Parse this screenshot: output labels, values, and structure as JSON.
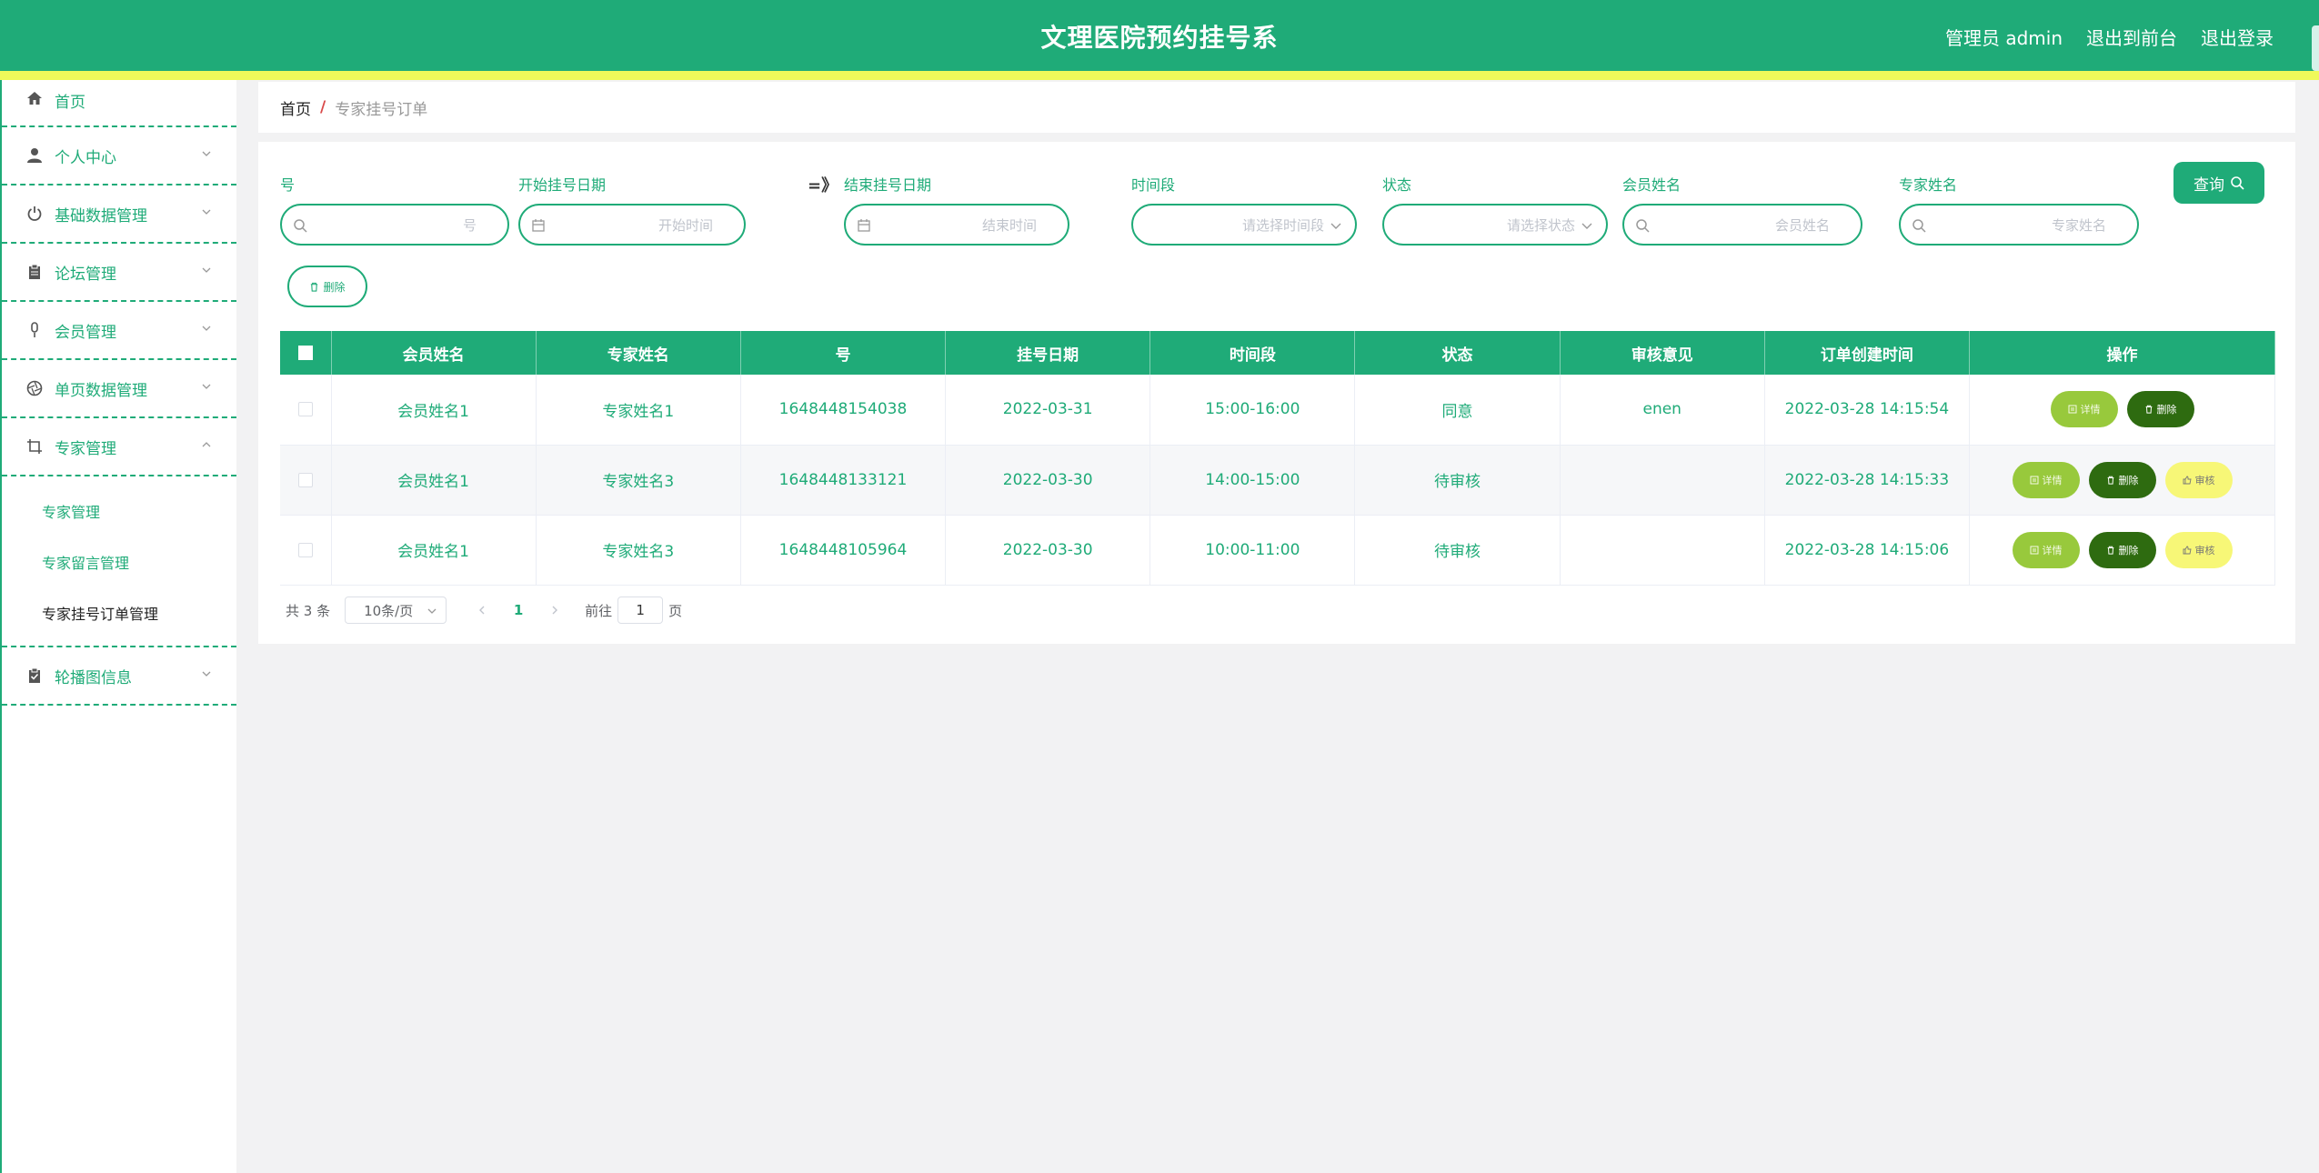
{
  "header": {
    "title": "文理医院预约挂号系",
    "user_label": "管理员 admin",
    "back_label": "退出到前台",
    "logout_label": "退出登录"
  },
  "sidebar": {
    "items": [
      {
        "label": "首页",
        "icon": "home-icon"
      },
      {
        "label": "个人中心",
        "icon": "user-icon"
      },
      {
        "label": "基础数据管理",
        "icon": "power-icon"
      },
      {
        "label": "论坛管理",
        "icon": "clipboard-icon"
      },
      {
        "label": "会员管理",
        "icon": "microphone-icon"
      },
      {
        "label": "单页数据管理",
        "icon": "aperture-icon"
      },
      {
        "label": "专家管理",
        "icon": "crop-icon"
      },
      {
        "label": "轮播图信息",
        "icon": "clipboard-check-icon"
      }
    ],
    "submenu": [
      "专家管理",
      "专家留言管理",
      "专家挂号订单管理"
    ]
  },
  "breadcrumb": {
    "home": "首页",
    "separator": "/",
    "current": "专家挂号订单"
  },
  "filters": {
    "number": {
      "label": "号",
      "placeholder": "号"
    },
    "start_date": {
      "label": "开始挂号日期",
      "placeholder": "开始时间"
    },
    "range_mark": "=》",
    "end_date": {
      "label": "结束挂号日期",
      "placeholder": "结束时间"
    },
    "time_slot": {
      "label": "时间段",
      "placeholder": "请选择时间段"
    },
    "status": {
      "label": "状态",
      "placeholder": "请选择状态"
    },
    "member_name": {
      "label": "会员姓名",
      "placeholder": "会员姓名"
    },
    "expert_name": {
      "label": "专家姓名",
      "placeholder": "专家姓名"
    },
    "query_label": "查询",
    "delete_label": "删除"
  },
  "table": {
    "columns": [
      "会员姓名",
      "专家姓名",
      "号",
      "挂号日期",
      "时间段",
      "状态",
      "审核意见",
      "订单创建时间",
      "操作"
    ],
    "rows": [
      {
        "member": "会员姓名1",
        "expert": "专家姓名1",
        "number": "1648448154038",
        "date": "2022-03-31",
        "slot": "15:00-16:00",
        "status": "同意",
        "opinion": "enen",
        "created": "2022-03-28 14:15:54"
      },
      {
        "member": "会员姓名1",
        "expert": "专家姓名3",
        "number": "1648448133121",
        "date": "2022-03-30",
        "slot": "14:00-15:00",
        "status": "待审核",
        "opinion": "",
        "created": "2022-03-28 14:15:33"
      },
      {
        "member": "会员姓名1",
        "expert": "专家姓名3",
        "number": "1648448105964",
        "date": "2022-03-30",
        "slot": "10:00-11:00",
        "status": "待审核",
        "opinion": "",
        "created": "2022-03-28 14:15:06"
      }
    ],
    "actions": {
      "detail": "详情",
      "delete": "删除",
      "audit": "审核"
    }
  },
  "pagination": {
    "total": "共 3 条",
    "page_size": "10条/页",
    "current_page": "1",
    "goto_label": "前往",
    "goto_value": "1",
    "page_suffix": "页"
  },
  "colors": {
    "primary": "#1fab78",
    "header_strip": "#eff95a",
    "detail_button": "#98c93c",
    "delete_button": "#2e6b10",
    "audit_button": "#f7f777"
  }
}
